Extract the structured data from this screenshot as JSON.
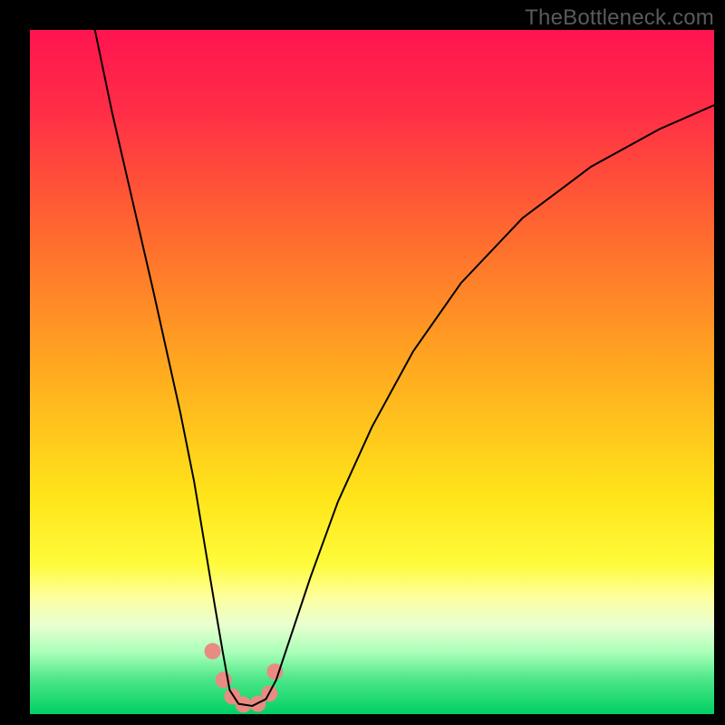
{
  "watermark": "TheBottleneck.com",
  "chart_data": {
    "type": "line",
    "title": "",
    "xlabel": "",
    "ylabel": "",
    "xlim": [
      0,
      100
    ],
    "ylim": [
      0,
      100
    ],
    "background_gradient_stops": [
      {
        "offset": 0.0,
        "color": "#ff1450"
      },
      {
        "offset": 0.12,
        "color": "#ff2e46"
      },
      {
        "offset": 0.3,
        "color": "#ff6a2f"
      },
      {
        "offset": 0.5,
        "color": "#ffab1f"
      },
      {
        "offset": 0.68,
        "color": "#ffe41a"
      },
      {
        "offset": 0.78,
        "color": "#fffb3a"
      },
      {
        "offset": 0.83,
        "color": "#fdffa0"
      },
      {
        "offset": 0.87,
        "color": "#e8ffd0"
      },
      {
        "offset": 0.91,
        "color": "#a8ffb8"
      },
      {
        "offset": 0.95,
        "color": "#4be687"
      },
      {
        "offset": 1.0,
        "color": "#00d062"
      }
    ],
    "series": [
      {
        "name": "bottleneck-curve",
        "color": "#000000",
        "stroke_width": 2,
        "x": [
          9.5,
          12,
          15,
          18,
          20,
          22,
          24,
          25.5,
          27,
          28.2,
          29.2,
          30.5,
          32.5,
          34.5,
          36,
          38,
          41,
          45,
          50,
          56,
          63,
          72,
          82,
          92,
          100
        ],
        "values": [
          100,
          88,
          75,
          62,
          53,
          44,
          34,
          25,
          16,
          9,
          3.5,
          1.5,
          1.2,
          2.2,
          5,
          11,
          20,
          31,
          42,
          53,
          63,
          72.5,
          80,
          85.5,
          89
        ]
      }
    ],
    "markers": {
      "name": "highlight-dots",
      "color": "#e98b82",
      "radius": 9,
      "x": [
        26.7,
        28.3,
        29.6,
        31.2,
        33.3,
        35.0,
        35.8
      ],
      "values": [
        9.2,
        5.0,
        2.6,
        1.4,
        1.5,
        3.0,
        6.2
      ]
    }
  }
}
